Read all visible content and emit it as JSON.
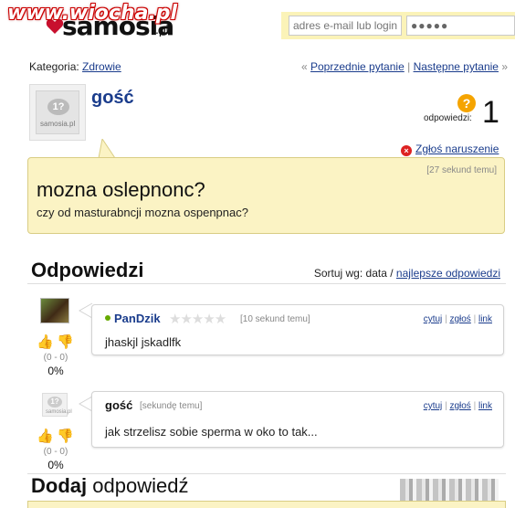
{
  "header": {
    "watermark": "www.wiocha.pl",
    "logo_text": "samosia",
    "logo_suffix": ".pl",
    "email_placeholder": "adres e-mail lub login",
    "password_value": "●●●●●"
  },
  "category": {
    "label": "Kategoria:",
    "link": "Zdrowie"
  },
  "nav": {
    "prev_arrow": "«",
    "prev": "Poprzednie pytanie",
    "separator": "|",
    "next": "Następne pytanie",
    "next_arrow": "»"
  },
  "question": {
    "author": "gość",
    "answers_label": "odpowiedzi:",
    "answers_count": "1",
    "report": "Zgłoś naruszenie",
    "time": "[27 sekund temu]",
    "title": "mozna oslepnonc?",
    "body": "czy od masturabncji mozna ospenpnac?"
  },
  "avatar": {
    "bubble": "1?",
    "brand": "samosia.pl"
  },
  "answers_section": {
    "title": "Odpowiedzi",
    "sort_label": "Sortuj wg:",
    "sort_data": "data",
    "sort_slash": "/",
    "sort_best": "najlepsze odpowiedzi"
  },
  "answers": [
    {
      "author": "PanDzik",
      "stars": "★★★★★",
      "time": "[10 sekund temu]",
      "cite": "cytuj",
      "report": "zgłoś",
      "link": "link",
      "text": "jhaskjl jskadlfk",
      "votes": "(0 - 0)",
      "percent": "0%"
    },
    {
      "author": "gość",
      "time": "[sekundę temu]",
      "cite": "cytuj",
      "report": "zgłoś",
      "link": "link",
      "text": "jak strzelisz sobie sperma w oko to tak...",
      "votes": "(0 - 0)",
      "percent": "0%"
    }
  ],
  "add_answer": {
    "bold": "Dodaj",
    "rest": "odpowiedź"
  },
  "icons": {
    "question_mark": "?",
    "report_x": "×",
    "thumb_up": "👍",
    "thumb_down": "👎",
    "action_sep": "|"
  },
  "colors": {
    "accent_link": "#1a3c8c",
    "question_bg": "#fbf3c4",
    "login_bar_bg": "#fbf3b8",
    "question_icon": "#f5a400",
    "report_icon": "#dd2222"
  }
}
